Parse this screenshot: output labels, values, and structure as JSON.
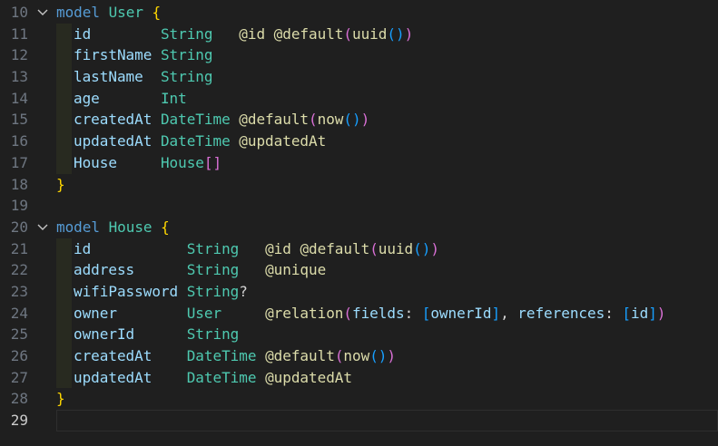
{
  "editor": {
    "language": "prisma",
    "active_line": 29,
    "colors": {
      "background": "#1f1f1f",
      "line_number": "#6e7681",
      "keyword": "#569cd6",
      "type": "#4ec9b0",
      "field": "#9cdcfe",
      "bracket_level1": "#ffd700",
      "bracket_level2": "#da70d6",
      "bracket_level3": "#179fff",
      "attribute": "#dcdcaa",
      "plain": "#d4d4d4"
    },
    "lines": [
      {
        "n": "10",
        "fold": true,
        "indent": false,
        "tokens": [
          [
            "t-keyword",
            "model"
          ],
          [
            "t-text",
            " "
          ],
          [
            "t-modelname",
            "User"
          ],
          [
            "t-text",
            " "
          ],
          [
            "t-bracket1",
            "{"
          ]
        ]
      },
      {
        "n": "11",
        "indent": true,
        "tokens": [
          [
            "t-fieldname",
            "id"
          ],
          [
            "t-text",
            "        "
          ],
          [
            "t-typeplain",
            "String"
          ],
          [
            "t-text",
            "   "
          ],
          [
            "t-attr",
            "@id"
          ],
          [
            "t-text",
            " "
          ],
          [
            "t-attr",
            "@default"
          ],
          [
            "t-bracket2",
            "("
          ],
          [
            "t-attr",
            "uuid"
          ],
          [
            "t-bracket3",
            "()"
          ],
          [
            "t-bracket2",
            ")"
          ]
        ]
      },
      {
        "n": "12",
        "indent": true,
        "tokens": [
          [
            "t-fieldname",
            "firstName"
          ],
          [
            "t-text",
            " "
          ],
          [
            "t-typeplain",
            "String"
          ]
        ]
      },
      {
        "n": "13",
        "indent": true,
        "tokens": [
          [
            "t-fieldname",
            "lastName"
          ],
          [
            "t-text",
            "  "
          ],
          [
            "t-typeplain",
            "String"
          ]
        ]
      },
      {
        "n": "14",
        "indent": true,
        "tokens": [
          [
            "t-fieldname",
            "age"
          ],
          [
            "t-text",
            "       "
          ],
          [
            "t-typeplain",
            "Int"
          ]
        ]
      },
      {
        "n": "15",
        "indent": true,
        "tokens": [
          [
            "t-fieldname",
            "createdAt"
          ],
          [
            "t-text",
            " "
          ],
          [
            "t-typeplain",
            "DateTime"
          ],
          [
            "t-text",
            " "
          ],
          [
            "t-attr",
            "@default"
          ],
          [
            "t-bracket2",
            "("
          ],
          [
            "t-attr",
            "now"
          ],
          [
            "t-bracket3",
            "()"
          ],
          [
            "t-bracket2",
            ")"
          ]
        ]
      },
      {
        "n": "16",
        "indent": true,
        "tokens": [
          [
            "t-fieldname",
            "updatedAt"
          ],
          [
            "t-text",
            " "
          ],
          [
            "t-typeplain",
            "DateTime"
          ],
          [
            "t-text",
            " "
          ],
          [
            "t-attr",
            "@updatedAt"
          ]
        ]
      },
      {
        "n": "17",
        "indent": true,
        "tokens": [
          [
            "t-fieldname",
            "House"
          ],
          [
            "t-text",
            "     "
          ],
          [
            "t-typeplain",
            "House"
          ],
          [
            "t-bracket2",
            "[]"
          ]
        ]
      },
      {
        "n": "18",
        "indent": false,
        "tokens": [
          [
            "t-bracket1",
            "}"
          ]
        ]
      },
      {
        "n": "19",
        "indent": false,
        "tokens": []
      },
      {
        "n": "20",
        "fold": true,
        "indent": false,
        "tokens": [
          [
            "t-keyword",
            "model"
          ],
          [
            "t-text",
            " "
          ],
          [
            "t-modelname",
            "House"
          ],
          [
            "t-text",
            " "
          ],
          [
            "t-bracket1",
            "{"
          ]
        ]
      },
      {
        "n": "21",
        "indent": true,
        "tokens": [
          [
            "t-fieldname",
            "id"
          ],
          [
            "t-text",
            "           "
          ],
          [
            "t-typeplain",
            "String"
          ],
          [
            "t-text",
            "   "
          ],
          [
            "t-attr",
            "@id"
          ],
          [
            "t-text",
            " "
          ],
          [
            "t-attr",
            "@default"
          ],
          [
            "t-bracket2",
            "("
          ],
          [
            "t-attr",
            "uuid"
          ],
          [
            "t-bracket3",
            "()"
          ],
          [
            "t-bracket2",
            ")"
          ]
        ]
      },
      {
        "n": "22",
        "indent": true,
        "tokens": [
          [
            "t-fieldname",
            "address"
          ],
          [
            "t-text",
            "      "
          ],
          [
            "t-typeplain",
            "String"
          ],
          [
            "t-text",
            "   "
          ],
          [
            "t-attr",
            "@unique"
          ]
        ]
      },
      {
        "n": "23",
        "indent": true,
        "tokens": [
          [
            "t-fieldname",
            "wifiPassword"
          ],
          [
            "t-text",
            " "
          ],
          [
            "t-typeplain",
            "String"
          ],
          [
            "t-text",
            "?"
          ]
        ]
      },
      {
        "n": "24",
        "indent": true,
        "tokens": [
          [
            "t-fieldname",
            "owner"
          ],
          [
            "t-text",
            "        "
          ],
          [
            "t-typeplain",
            "User"
          ],
          [
            "t-text",
            "     "
          ],
          [
            "t-attr",
            "@relation"
          ],
          [
            "t-bracket2",
            "("
          ],
          [
            "t-fieldname",
            "fields"
          ],
          [
            "t-text",
            ": "
          ],
          [
            "t-bracket3",
            "["
          ],
          [
            "t-fieldname",
            "ownerId"
          ],
          [
            "t-bracket3",
            "]"
          ],
          [
            "t-text",
            ", "
          ],
          [
            "t-fieldname",
            "references"
          ],
          [
            "t-text",
            ": "
          ],
          [
            "t-bracket3",
            "["
          ],
          [
            "t-fieldname",
            "id"
          ],
          [
            "t-bracket3",
            "]"
          ],
          [
            "t-bracket2",
            ")"
          ]
        ]
      },
      {
        "n": "25",
        "indent": true,
        "tokens": [
          [
            "t-fieldname",
            "ownerId"
          ],
          [
            "t-text",
            "      "
          ],
          [
            "t-typeplain",
            "String"
          ]
        ]
      },
      {
        "n": "26",
        "indent": true,
        "tokens": [
          [
            "t-fieldname",
            "createdAt"
          ],
          [
            "t-text",
            "    "
          ],
          [
            "t-typeplain",
            "DateTime"
          ],
          [
            "t-text",
            " "
          ],
          [
            "t-attr",
            "@default"
          ],
          [
            "t-bracket2",
            "("
          ],
          [
            "t-attr",
            "now"
          ],
          [
            "t-bracket3",
            "()"
          ],
          [
            "t-bracket2",
            ")"
          ]
        ]
      },
      {
        "n": "27",
        "indent": true,
        "tokens": [
          [
            "t-fieldname",
            "updatedAt"
          ],
          [
            "t-text",
            "    "
          ],
          [
            "t-typeplain",
            "DateTime"
          ],
          [
            "t-text",
            " "
          ],
          [
            "t-attr",
            "@updatedAt"
          ]
        ]
      },
      {
        "n": "28",
        "indent": false,
        "tokens": [
          [
            "t-bracket1",
            "}"
          ]
        ]
      },
      {
        "n": "29",
        "indent": false,
        "tokens": []
      }
    ]
  }
}
